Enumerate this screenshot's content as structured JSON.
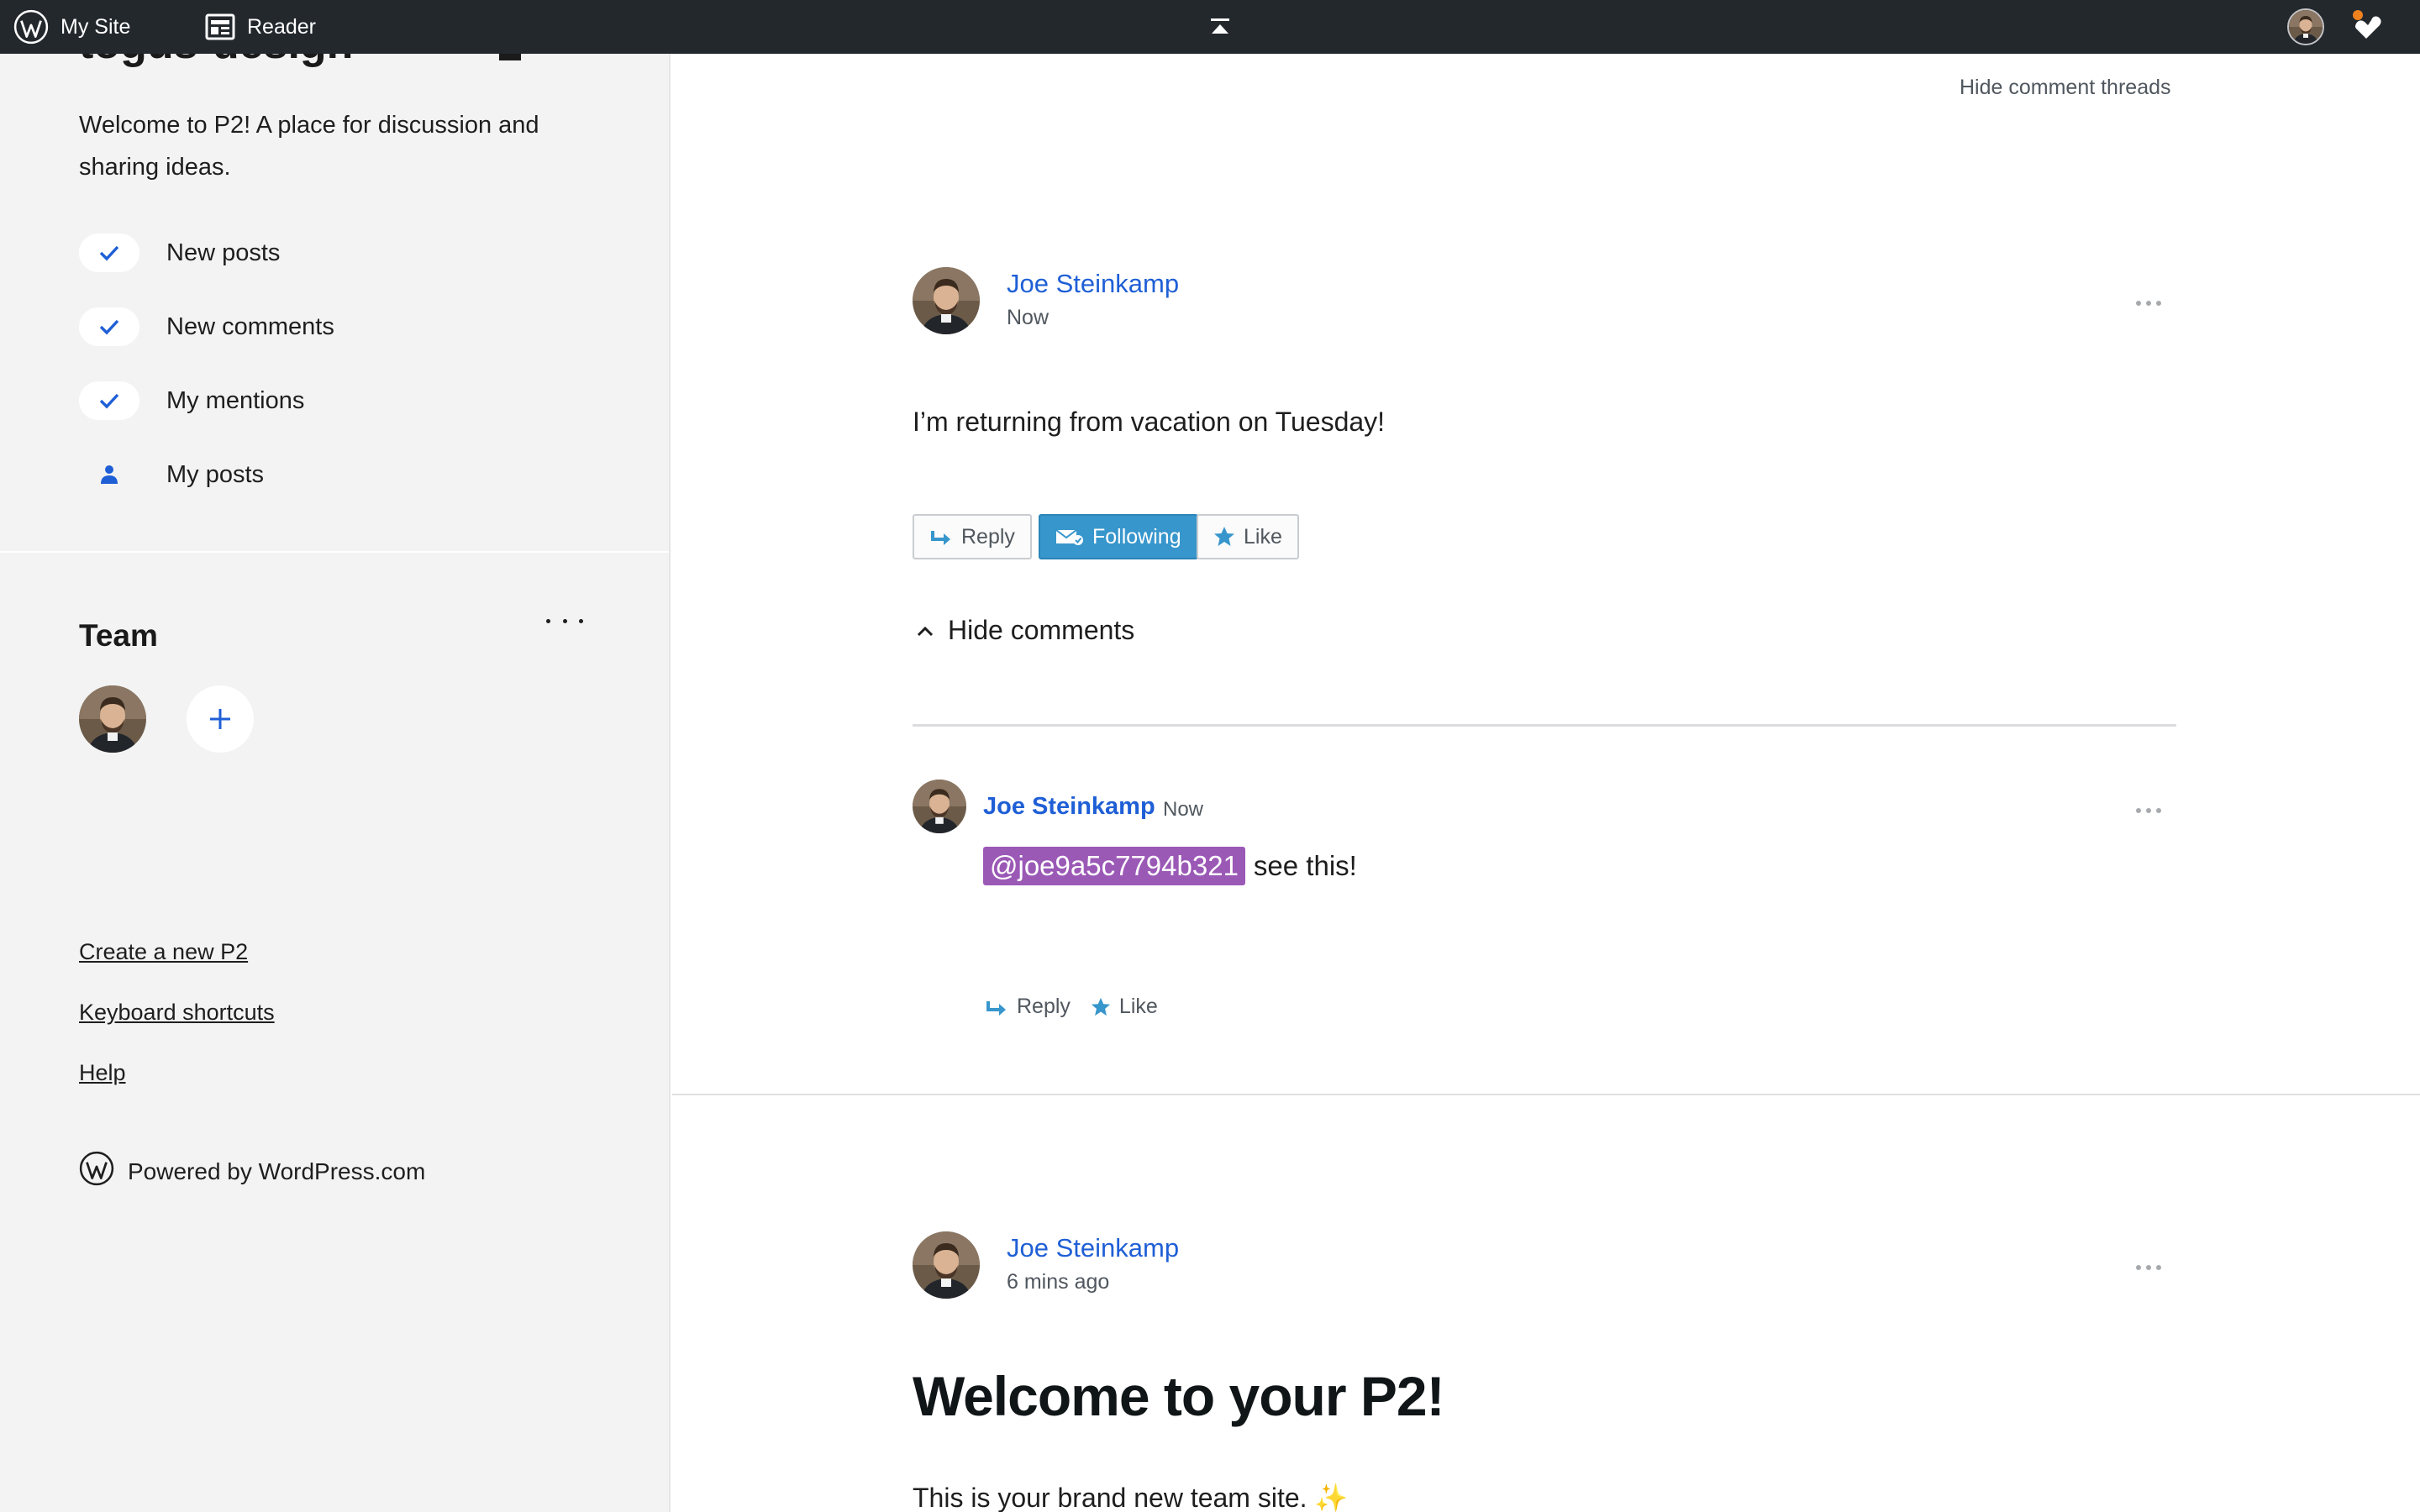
{
  "admin_bar": {
    "my_site_label": "My Site",
    "reader_label": "Reader"
  },
  "sidebar": {
    "site_title": "togus-design",
    "description": "Welcome to P2! A place for discussion and sharing ideas.",
    "follow_options": [
      {
        "label": "New posts",
        "checked": true
      },
      {
        "label": "New comments",
        "checked": true
      },
      {
        "label": "My mentions",
        "checked": true
      },
      {
        "label": "My posts",
        "checked": false
      }
    ],
    "team_heading": "Team",
    "links": [
      {
        "label": "Create a new P2"
      },
      {
        "label": "Keyboard shortcuts"
      },
      {
        "label": "Help"
      }
    ],
    "powered_by": "Powered by WordPress.com"
  },
  "main": {
    "hide_threads_label": "Hide comment threads",
    "post1": {
      "author": "Joe Steinkamp",
      "time": "Now",
      "body": "I’m returning from vacation on Tuesday!",
      "actions": {
        "reply": "Reply",
        "following": "Following",
        "like": "Like"
      },
      "toggle_comments": "Hide comments",
      "comment": {
        "author": "Joe Steinkamp",
        "time": "Now",
        "mention": "@joe9a5c7794b321",
        "text": "see this!",
        "reply": "Reply",
        "like": "Like"
      }
    },
    "post2": {
      "author": "Joe Steinkamp",
      "time": "6 mins ago",
      "title": "Welcome to your P2!",
      "body": "This is your brand new team site. ✨"
    }
  },
  "colors": {
    "admin_bar_bg": "#23282d",
    "link_blue": "#1f5fd6",
    "following_button": "#3796cc",
    "mention_bg": "#9b59b6",
    "sidebar_bg": "#f3f3f3"
  }
}
